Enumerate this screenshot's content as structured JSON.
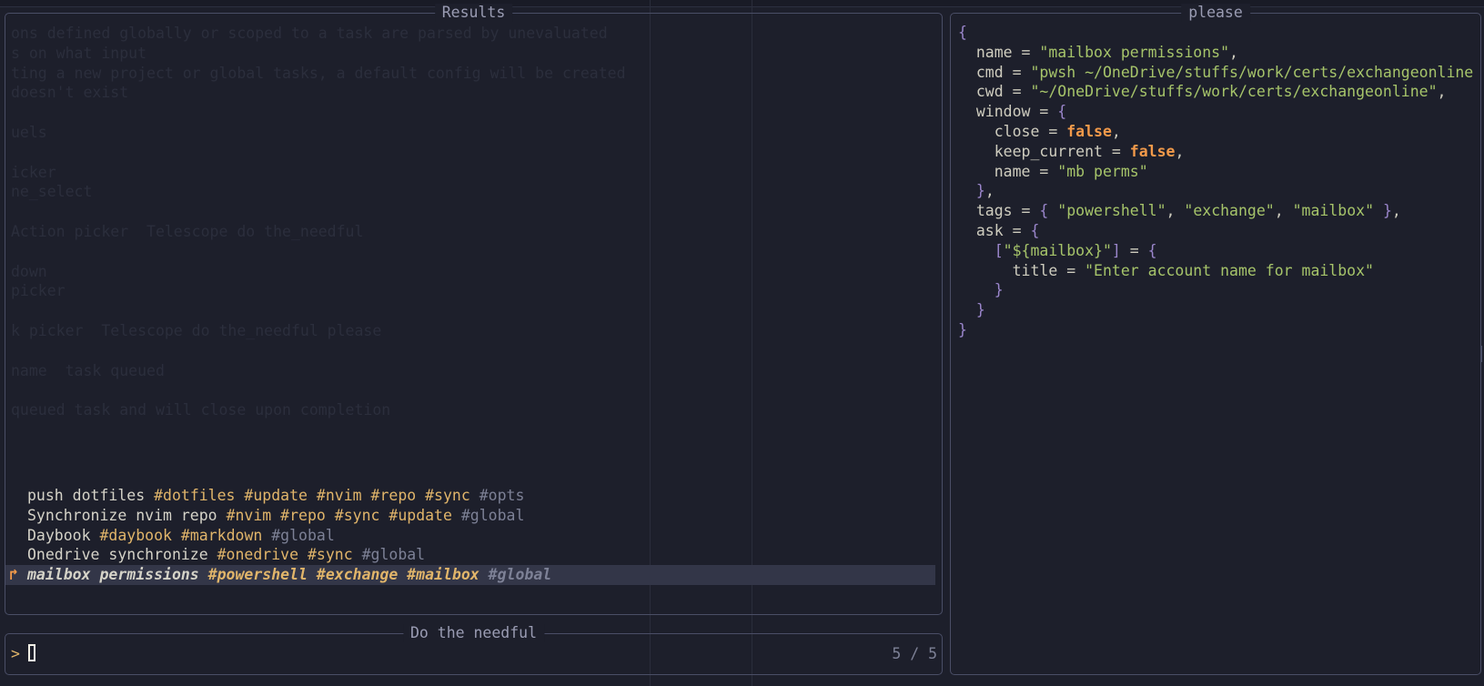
{
  "results": {
    "title": "Results",
    "items": [
      {
        "name": "push dotfiles",
        "tags": [
          "#dotfiles",
          "#update",
          "#nvim",
          "#repo",
          "#sync"
        ],
        "scope": "#opts",
        "selected": false
      },
      {
        "name": "Synchronize nvim repo",
        "tags": [
          "#nvim",
          "#repo",
          "#sync",
          "#update"
        ],
        "scope": "#global",
        "selected": false
      },
      {
        "name": "Daybook",
        "tags": [
          "#daybook",
          "#markdown"
        ],
        "scope": "#global",
        "selected": false
      },
      {
        "name": "Onedrive synchronize",
        "tags": [
          "#onedrive",
          "#sync"
        ],
        "scope": "#global",
        "selected": false
      },
      {
        "name": "mailbox permissions",
        "tags": [
          "#powershell",
          "#exchange",
          "#mailbox"
        ],
        "scope": "#global",
        "selected": true
      }
    ],
    "selection_caret": "↱"
  },
  "prompt": {
    "title": "Do the needful",
    "symbol": ">",
    "value": "",
    "counter": "5 / 5"
  },
  "preview": {
    "title": "please",
    "lines": [
      [
        [
          "{",
          "p"
        ]
      ],
      [
        [
          "  name",
          "k"
        ],
        [
          " = ",
          "k"
        ],
        [
          "\"mailbox permissions\"",
          "s"
        ],
        [
          ",",
          "k"
        ]
      ],
      [
        [
          "  cmd",
          "k"
        ],
        [
          " = ",
          "k"
        ],
        [
          "\"pwsh ~/OneDrive/stuffs/work/certs/exchangeonline",
          "s"
        ]
      ],
      [
        [
          "  cwd",
          "k"
        ],
        [
          " = ",
          "k"
        ],
        [
          "\"~/OneDrive/stuffs/work/certs/exchangeonline\"",
          "s"
        ],
        [
          ",",
          "k"
        ]
      ],
      [
        [
          "  window",
          "k"
        ],
        [
          " = ",
          "k"
        ],
        [
          "{",
          "p"
        ]
      ],
      [
        [
          "    close",
          "k"
        ],
        [
          " = ",
          "k"
        ],
        [
          "false",
          "b"
        ],
        [
          ",",
          "k"
        ]
      ],
      [
        [
          "    keep_current",
          "k"
        ],
        [
          " = ",
          "k"
        ],
        [
          "false",
          "b"
        ],
        [
          ",",
          "k"
        ]
      ],
      [
        [
          "    name",
          "k"
        ],
        [
          " = ",
          "k"
        ],
        [
          "\"mb perms\"",
          "s"
        ]
      ],
      [
        [
          "  }",
          "p"
        ],
        [
          ",",
          "k"
        ]
      ],
      [
        [
          "  tags",
          "k"
        ],
        [
          " = ",
          "k"
        ],
        [
          "{ ",
          "p"
        ],
        [
          "\"powershell\"",
          "s"
        ],
        [
          ", ",
          "k"
        ],
        [
          "\"exchange\"",
          "s"
        ],
        [
          ", ",
          "k"
        ],
        [
          "\"mailbox\"",
          "s"
        ],
        [
          " }",
          "p"
        ],
        [
          ",",
          "k"
        ]
      ],
      [
        [
          "  ask",
          "k"
        ],
        [
          " = ",
          "k"
        ],
        [
          "{",
          "p"
        ]
      ],
      [
        [
          "    [",
          "p"
        ],
        [
          "\"${mailbox}\"",
          "s"
        ],
        [
          "]",
          "p"
        ],
        [
          " = ",
          "k"
        ],
        [
          "{",
          "p"
        ]
      ],
      [
        [
          "      title",
          "k"
        ],
        [
          " = ",
          "k"
        ],
        [
          "\"Enter account name for mailbox\"",
          "s"
        ]
      ],
      [
        [
          "    }",
          "p"
        ]
      ],
      [
        [
          "  }",
          "p"
        ]
      ],
      [
        [
          "}",
          "p"
        ]
      ]
    ]
  },
  "background_text": [
    "ons defined globally or scoped to a task are parsed by unevaluated",
    "s on what input",
    "ting a new project or global tasks, a default config will be created",
    "doesn't exist",
    "",
    "uels",
    "",
    "icker",
    "ne_select",
    "",
    "Action picker  Telescope do the_needful",
    "",
    "down",
    "picker",
    "",
    "k picker  Telescope do the_needful please",
    "",
    "name  task queued",
    "",
    "queued task and will close upon completion"
  ]
}
